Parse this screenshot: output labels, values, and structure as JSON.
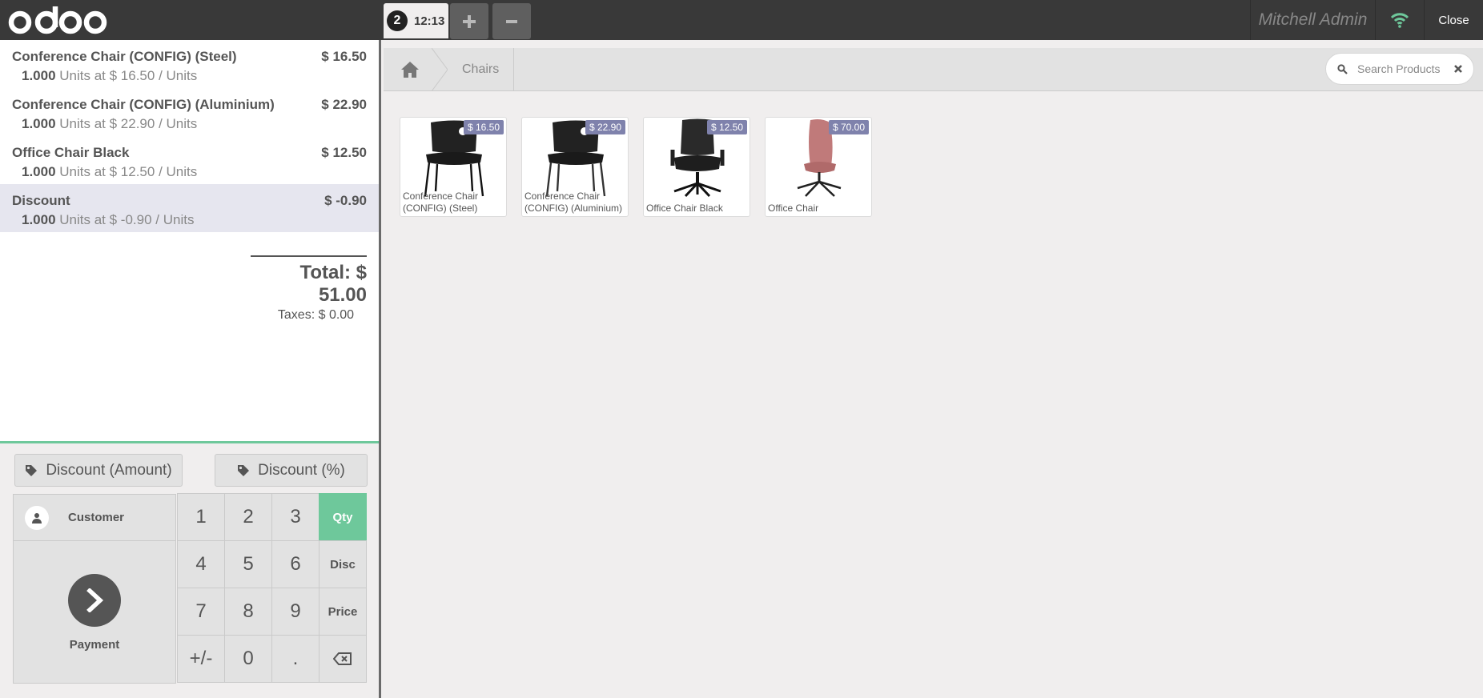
{
  "topbar": {
    "logo": "odoo",
    "order_number": "2",
    "order_time": "12:13",
    "add_order_icon": "plus-icon",
    "remove_order_icon": "minus-icon",
    "user_name": "Mitchell Admin",
    "wifi_icon": "wifi-icon",
    "close_label": "Close"
  },
  "colors": {
    "topbar_bg": "#393939",
    "accent_green": "#6ec89b",
    "price_tag": "#7f82ac",
    "wifi_green": "#6ec89b"
  },
  "order": {
    "lines": [
      {
        "name": "Conference Chair (CONFIG) (Steel)",
        "price": "$ 16.50",
        "qty": "1.000",
        "info": " Units at $ 16.50 / Units"
      },
      {
        "name": "Conference Chair (CONFIG) (Aluminium)",
        "price": "$ 22.90",
        "qty": "1.000",
        "info": " Units at $ 22.90 / Units"
      },
      {
        "name": "Office Chair Black",
        "price": "$ 12.50",
        "qty": "1.000",
        "info": " Units at $ 12.50 / Units"
      },
      {
        "name": "Discount",
        "price": "$ -0.90",
        "qty": "1.000",
        "info": " Units at $ -0.90 / Units"
      }
    ],
    "total": "Total: $ 51.00",
    "taxes": "Taxes: $ 0.00"
  },
  "controls": {
    "discount_amount": "Discount (Amount)",
    "discount_percent": "Discount (%)"
  },
  "actionpad": {
    "customer": "Customer",
    "payment": "Payment"
  },
  "numpad": {
    "keys": [
      "1",
      "2",
      "3",
      "Qty",
      "4",
      "5",
      "6",
      "Disc",
      "7",
      "8",
      "9",
      "Price",
      "+/-",
      "0",
      ".",
      "⌫"
    ],
    "active_mode": "Qty"
  },
  "products_screen": {
    "breadcrumb": "Chairs",
    "search_placeholder": "Search Products",
    "products": [
      {
        "name": "Conference Chair (CONFIG) (Steel)",
        "price": "$ 16.50"
      },
      {
        "name": "Conference Chair (CONFIG) (Aluminium)",
        "price": "$ 22.90"
      },
      {
        "name": "Office Chair Black",
        "price": "$ 12.50"
      },
      {
        "name": "Office Chair",
        "price": "$ 70.00"
      }
    ]
  }
}
